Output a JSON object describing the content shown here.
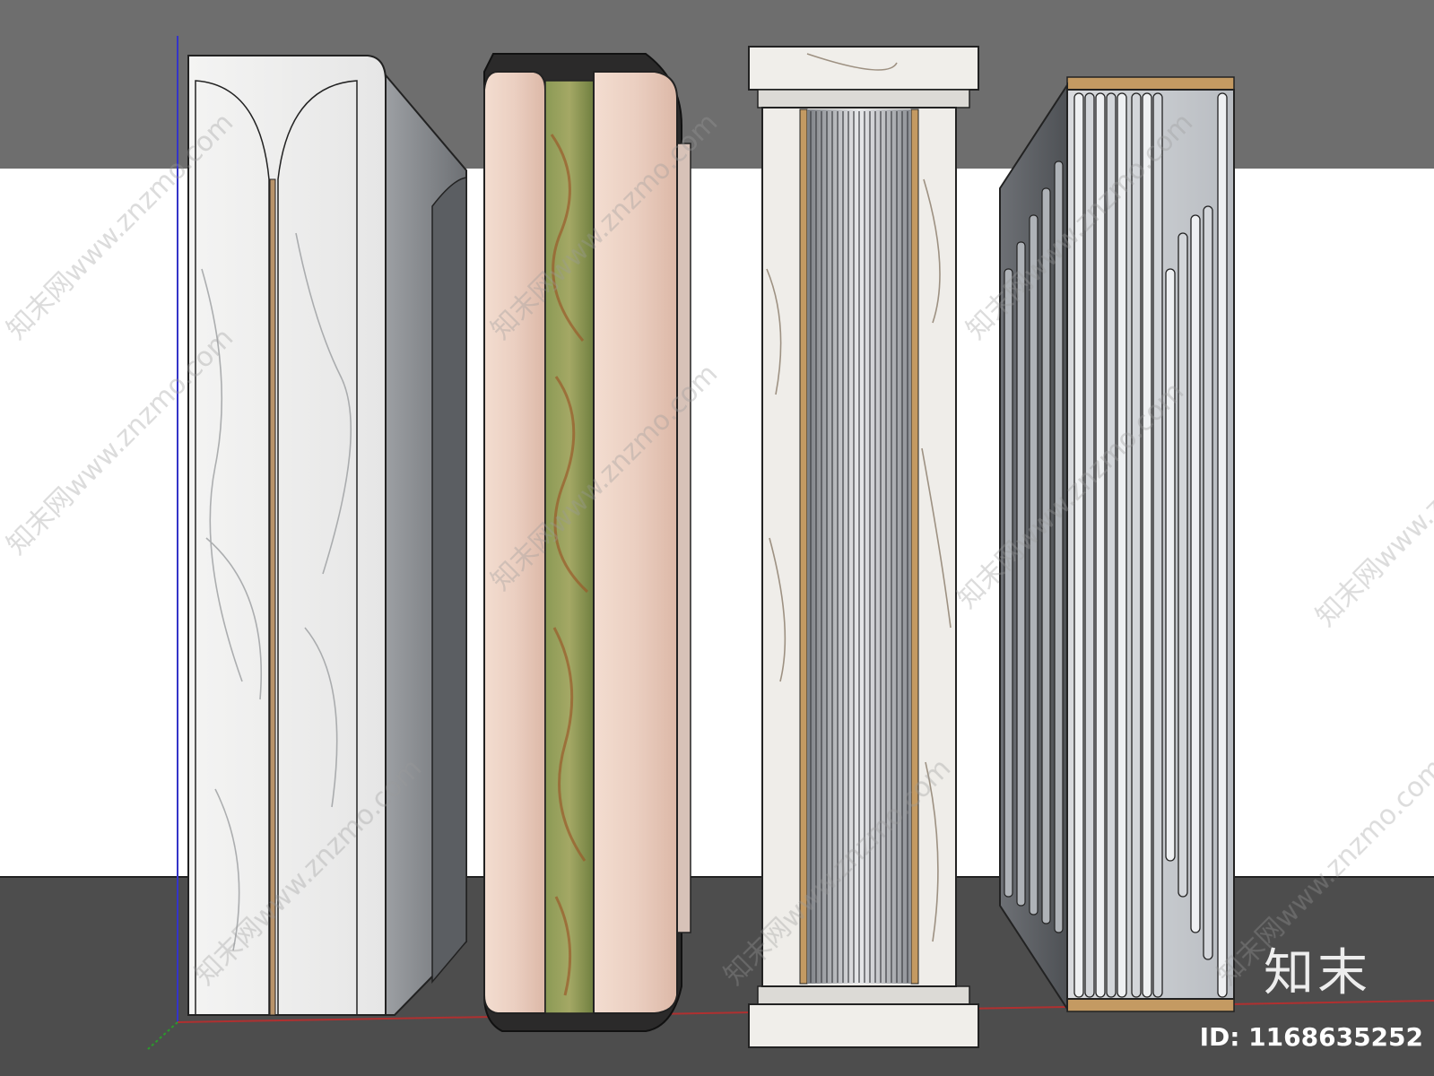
{
  "watermark": {
    "text": "知末网www.znzmo.com",
    "brand_mark": "知末",
    "id_label": "ID: 1168635252"
  },
  "colors": {
    "ceiling": "#6e6e6e",
    "wall": "#ffffff",
    "floor": "#4d4d4d",
    "marble_white": "#f1f0ef",
    "marble_grey": "#8d8f92",
    "pink_stone": "#ecd1c3",
    "onyx_green": "#7f8f4a",
    "brass": "#b8936a",
    "dark_frame": "#2b2a2a"
  },
  "columns": [
    {
      "name": "white-marble-arch-column"
    },
    {
      "name": "pink-onyx-rounded-column"
    },
    {
      "name": "fluted-marble-column"
    },
    {
      "name": "grey-fluted-panel-column"
    }
  ]
}
